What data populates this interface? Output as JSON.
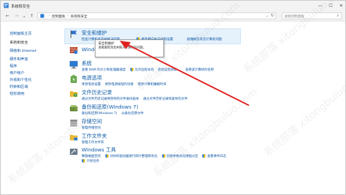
{
  "window": {
    "title": "系统和安全",
    "controls": {
      "minimize": "—",
      "maximize": "☐",
      "close": "✕"
    }
  },
  "nav": {
    "back": "←",
    "forward": "→",
    "recent": "⌄",
    "up": "↑",
    "breadcrumb": [
      "控制面板",
      "系统和安全"
    ],
    "search_placeholder": "搜索控制面板"
  },
  "sidebar": {
    "items": [
      {
        "label": "控制面板主页",
        "link": true
      },
      {
        "label": "系统和安全",
        "link": false
      },
      {
        "label": "网络和 Internet",
        "link": true
      },
      {
        "label": "硬件和声音",
        "link": true
      },
      {
        "label": "程序",
        "link": true
      },
      {
        "label": "用户帐户",
        "link": true
      },
      {
        "label": "外观和个性化",
        "link": true
      },
      {
        "label": "时钟和区域",
        "link": true
      },
      {
        "label": "轻松使用",
        "link": true
      }
    ]
  },
  "categories": [
    {
      "title": "安全和维护",
      "links": [
        "检查计算机状态并解决问题",
        "更改用户帐户控制设置",
        "疑难解答常见计算机问题"
      ]
    },
    {
      "title": "Windows Defender 防火墙",
      "links": []
    },
    {
      "title": "系统",
      "links": [
        "查看 RAM 的大小和处理器速度",
        "允许远程访问",
        "启动远程协助",
        "查看该计算机的名称"
      ]
    },
    {
      "title": "电源选项",
      "links": [
        "更改电池设置",
        "更改电源按钮的功能",
        "更改计算机睡眠时间"
      ]
    },
    {
      "title": "文件历史记录",
      "links": [
        "通过文件历史记录保存你的文件备份副本",
        "通过文件历史记录恢复你的文件"
      ]
    },
    {
      "title": "备份和还原(Windows 7)",
      "links": [
        "备份和还原(Windows 7)",
        "从备份还原文件"
      ]
    },
    {
      "title": "存储空间",
      "links": [
        "管理存储空间"
      ]
    },
    {
      "title": "工作文件夹",
      "links": [
        "管理工作文件夹"
      ]
    },
    {
      "title": "Windows 工具",
      "links": [
        "释放磁盘空间",
        "对你的驱动器进行碎片整理和优化",
        "创建并格式化硬盘分区",
        "查看事件日志",
        "计划任务"
      ]
    }
  ],
  "tooltip": {
    "title": "安全和维护",
    "body": "查看最新消息并解决计算机的问题。"
  },
  "watermark": "系统部落 xitongbuluo.com",
  "colors": {
    "link": "#0b55a6",
    "title": "#0b5aa8",
    "arrow": "#e02020",
    "highlight": "#e5f1fb"
  }
}
